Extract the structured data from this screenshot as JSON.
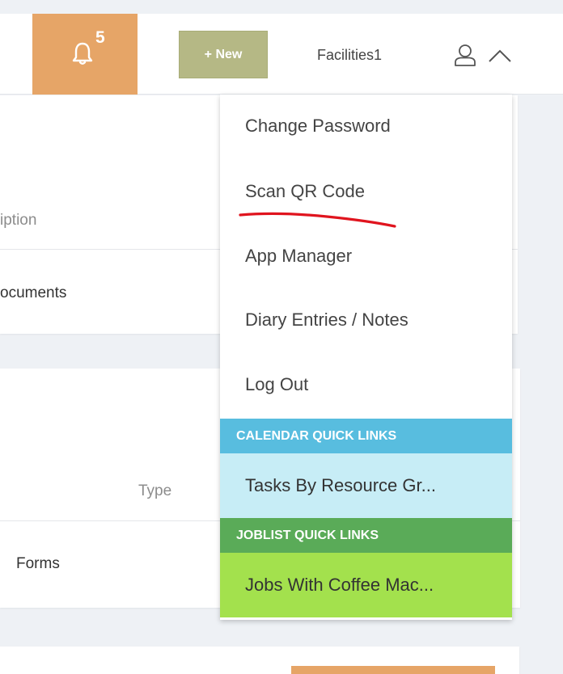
{
  "header": {
    "notification_count": "5",
    "new_button_label": "+ New",
    "username": "Facilities1",
    "icons": {
      "bell": "bell-icon",
      "user": "user-icon",
      "menu_toggle": "chevron-up-icon"
    }
  },
  "cards": [
    {
      "column_header": "iption",
      "row_text": "ocuments"
    },
    {
      "column_header": "Type",
      "row_text": "Forms"
    }
  ],
  "user_menu": {
    "items": [
      {
        "label": "Change Password"
      },
      {
        "label": "Scan QR Code"
      },
      {
        "label": "App Manager"
      },
      {
        "label": "Diary Entries / Notes"
      },
      {
        "label": "Log Out"
      }
    ],
    "calendar_section": {
      "header": "CALENDAR QUICK LINKS",
      "links": [
        {
          "label": "Tasks By Resource Gr..."
        }
      ]
    },
    "joblist_section": {
      "header": "JOBLIST QUICK LINKS",
      "links": [
        {
          "label": "Jobs With Coffee Mac..."
        }
      ]
    }
  },
  "colors": {
    "bell_tile": "#e6a567",
    "new_button": "#b5b885",
    "calendar_header": "#58bddf",
    "calendar_link_bg": "#c7edf6",
    "joblist_header": "#5aab58",
    "joblist_link_bg": "#a3e14d",
    "annotation": "#e0141e"
  }
}
